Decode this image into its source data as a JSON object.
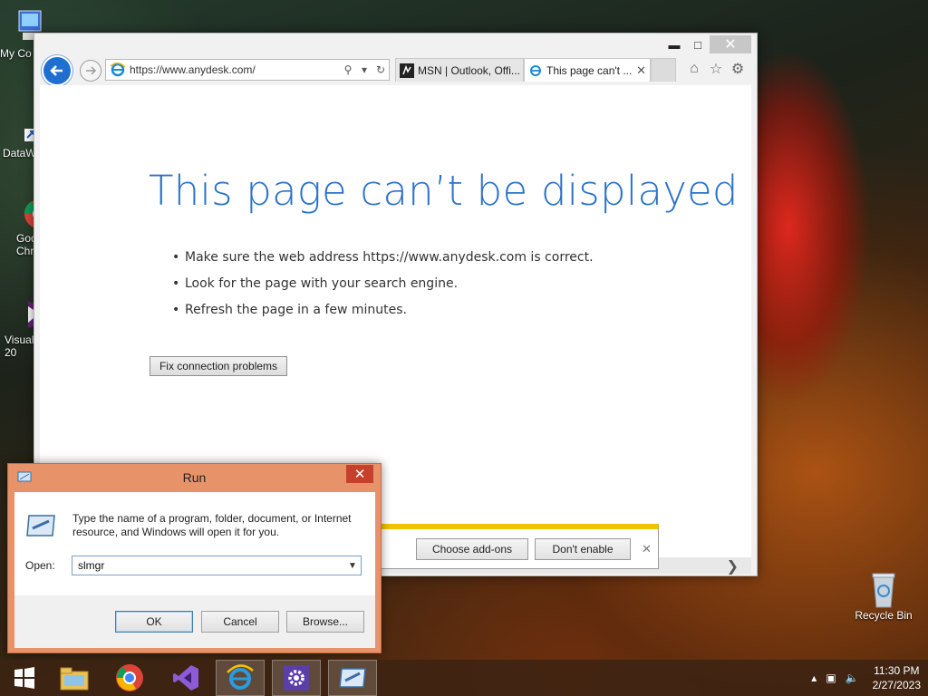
{
  "desktop": {
    "icons": [
      {
        "label": "My Co"
      },
      {
        "label": "DataW"
      },
      {
        "label": "Goo Chr"
      },
      {
        "label": "Visual 20"
      },
      {
        "label": "Recycle Bin"
      }
    ]
  },
  "browser": {
    "url": "https://www.anydesk.com/",
    "tabs": [
      {
        "label": "MSN | Outlook, Offi..."
      },
      {
        "label": "This page can't ..."
      }
    ],
    "error": {
      "title": "This page can’t be displayed",
      "bullets": [
        "Make sure the web address https://www.anydesk.com is correct.",
        "Look for the page with your search engine.",
        "Refresh the page in a few minutes."
      ],
      "fix_button": "Fix connection problems"
    },
    "notification": {
      "choose_addons": "Choose add-ons",
      "dont_enable": "Don't enable"
    }
  },
  "run_dialog": {
    "title": "Run",
    "description": "Type the name of a program, folder, document, or Internet resource, and Windows will open it for you.",
    "open_label": "Open:",
    "open_value": "slmgr",
    "ok": "OK",
    "cancel": "Cancel",
    "browse": "Browse..."
  },
  "taskbar": {
    "time": "11:30 PM",
    "date": "2/27/2023"
  },
  "colors": {
    "error_title": "#2c73c9",
    "run_frame": "#e8926a",
    "notification_accent": "#f0c300"
  }
}
